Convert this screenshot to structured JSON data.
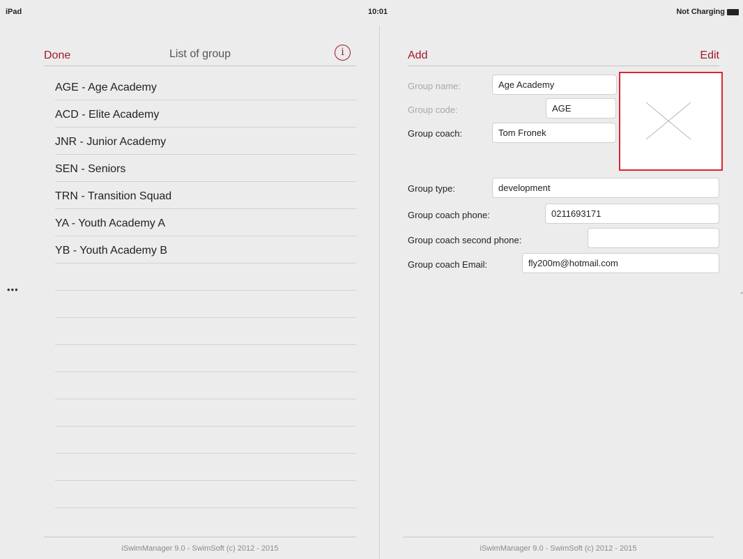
{
  "status_bar": {
    "device": "iPad",
    "time": "10:01",
    "battery_status": "Not Charging"
  },
  "left_panel": {
    "done_label": "Done",
    "title": "List of group",
    "info_icon": "i",
    "groups": [
      "AGE - Age Academy",
      "ACD - Elite Academy",
      "JNR - Junior Academy",
      "SEN - Seniors",
      "TRN - Transition Squad",
      "YA - Youth Academy A",
      "YB - Youth Academy B"
    ],
    "footer": "iSwimManager 9.0 - SwimSoft (c) 2012 - 2015"
  },
  "right_panel": {
    "add_label": "Add",
    "edit_label": "Edit",
    "fields": {
      "group_name": {
        "label": "Group name:",
        "value": "Age Academy"
      },
      "group_code": {
        "label": "Group code:",
        "value": "AGE"
      },
      "group_coach": {
        "label": "Group coach:",
        "value": "Tom Fronek"
      },
      "group_type": {
        "label": "Group type:",
        "value": "development"
      },
      "coach_phone": {
        "label": "Group coach phone:",
        "value": "0211693171"
      },
      "coach_second_phone": {
        "label": "Group coach second phone:",
        "value": ""
      },
      "coach_email": {
        "label": "Group coach Email:",
        "value": "fly200m@hotmail.com"
      }
    },
    "footer": "iSwimManager 9.0 - SwimSoft (c) 2012 - 2015"
  },
  "side_handles": {
    "left": "•••",
    "right": "·"
  },
  "colors": {
    "accent": "#a0182a",
    "photo_border": "#d9262e",
    "background": "#ececec"
  },
  "icons": {
    "info": "info-circle-icon",
    "photo_placeholder": "empty-image-x-icon",
    "battery": "battery-icon"
  }
}
